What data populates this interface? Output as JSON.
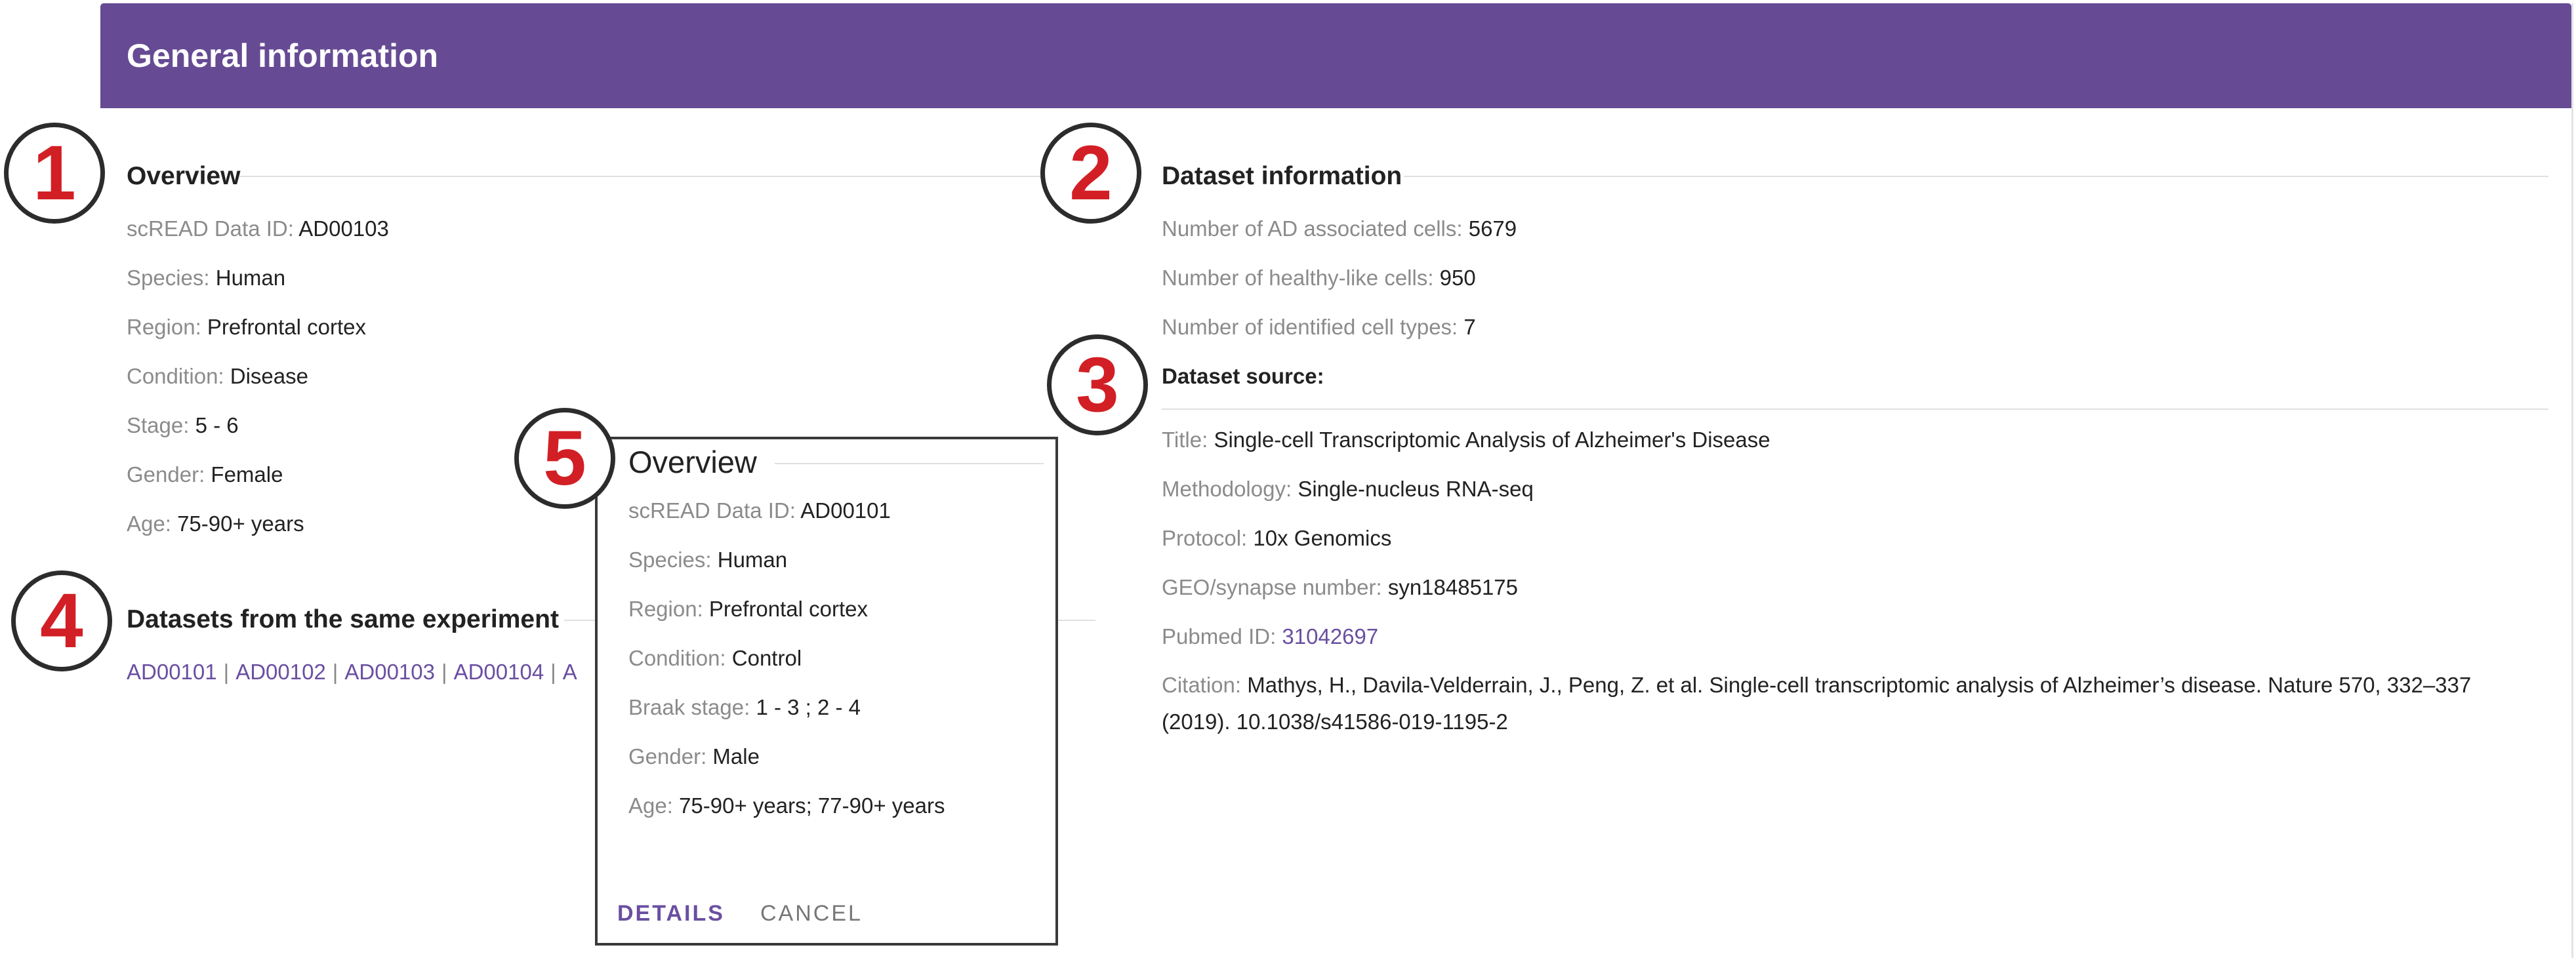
{
  "header": {
    "title": "General information"
  },
  "overview": {
    "title": "Overview",
    "fields": [
      {
        "label": "scREAD Data ID: ",
        "value": "AD00103"
      },
      {
        "label": "Species: ",
        "value": "Human"
      },
      {
        "label": "Region: ",
        "value": "Prefrontal cortex"
      },
      {
        "label": "Condition: ",
        "value": "Disease"
      },
      {
        "label": "Stage: ",
        "value": "5 - 6"
      },
      {
        "label": "Gender: ",
        "value": "Female"
      },
      {
        "label": "Age: ",
        "value": "75-90+ years"
      }
    ]
  },
  "same_experiment": {
    "title": "Datasets from the same experiment",
    "links": [
      "AD00101",
      "AD00102",
      "AD00103",
      "AD00104",
      "A"
    ],
    "separator": "|"
  },
  "dataset_info": {
    "title": "Dataset information",
    "fields": [
      {
        "label": "Number of AD associated cells: ",
        "value": "5679"
      },
      {
        "label": "Number of healthy-like cells: ",
        "value": "950"
      },
      {
        "label": "Number of identified cell types: ",
        "value": "7"
      }
    ]
  },
  "dataset_source": {
    "title": "Dataset source:",
    "fields": [
      {
        "label": "Title: ",
        "value": "Single-cell Transcriptomic Analysis of Alzheimer's Disease"
      },
      {
        "label": "Methodology: ",
        "value": "Single-nucleus RNA-seq"
      },
      {
        "label": "Protocol: ",
        "value": "10x Genomics"
      },
      {
        "label": "GEO/synapse number: ",
        "value": "syn18485175"
      },
      {
        "label": "Pubmed ID: ",
        "value": "31042697"
      }
    ],
    "citation": {
      "label": "Citation: ",
      "value": "Mathys, H., Davila-Velderrain, J., Peng, Z. et al. Single-cell transcriptomic analysis of Alzheimer’s disease. Nature 570, 332–337 (2019). 10.1038/s41586-019-1195-2"
    }
  },
  "popup": {
    "title": "Overview",
    "fields": [
      {
        "label": "scREAD Data ID: ",
        "value": "AD00101"
      },
      {
        "label": "Species: ",
        "value": "Human"
      },
      {
        "label": "Region: ",
        "value": "Prefrontal cortex"
      },
      {
        "label": "Condition: ",
        "value": "Control"
      },
      {
        "label": "Braak stage: ",
        "value": "1 - 3 ; 2 - 4"
      },
      {
        "label": "Gender: ",
        "value": "Male"
      },
      {
        "label": "Age: ",
        "value": "75-90+ years; 77-90+ years"
      }
    ],
    "details_label": "Details",
    "cancel_label": "Cancel"
  },
  "markers": [
    "1",
    "2",
    "3",
    "4",
    "5"
  ],
  "colors": {
    "header": "#664b94",
    "link": "#6a4fa0",
    "marker": "#d21f25"
  }
}
